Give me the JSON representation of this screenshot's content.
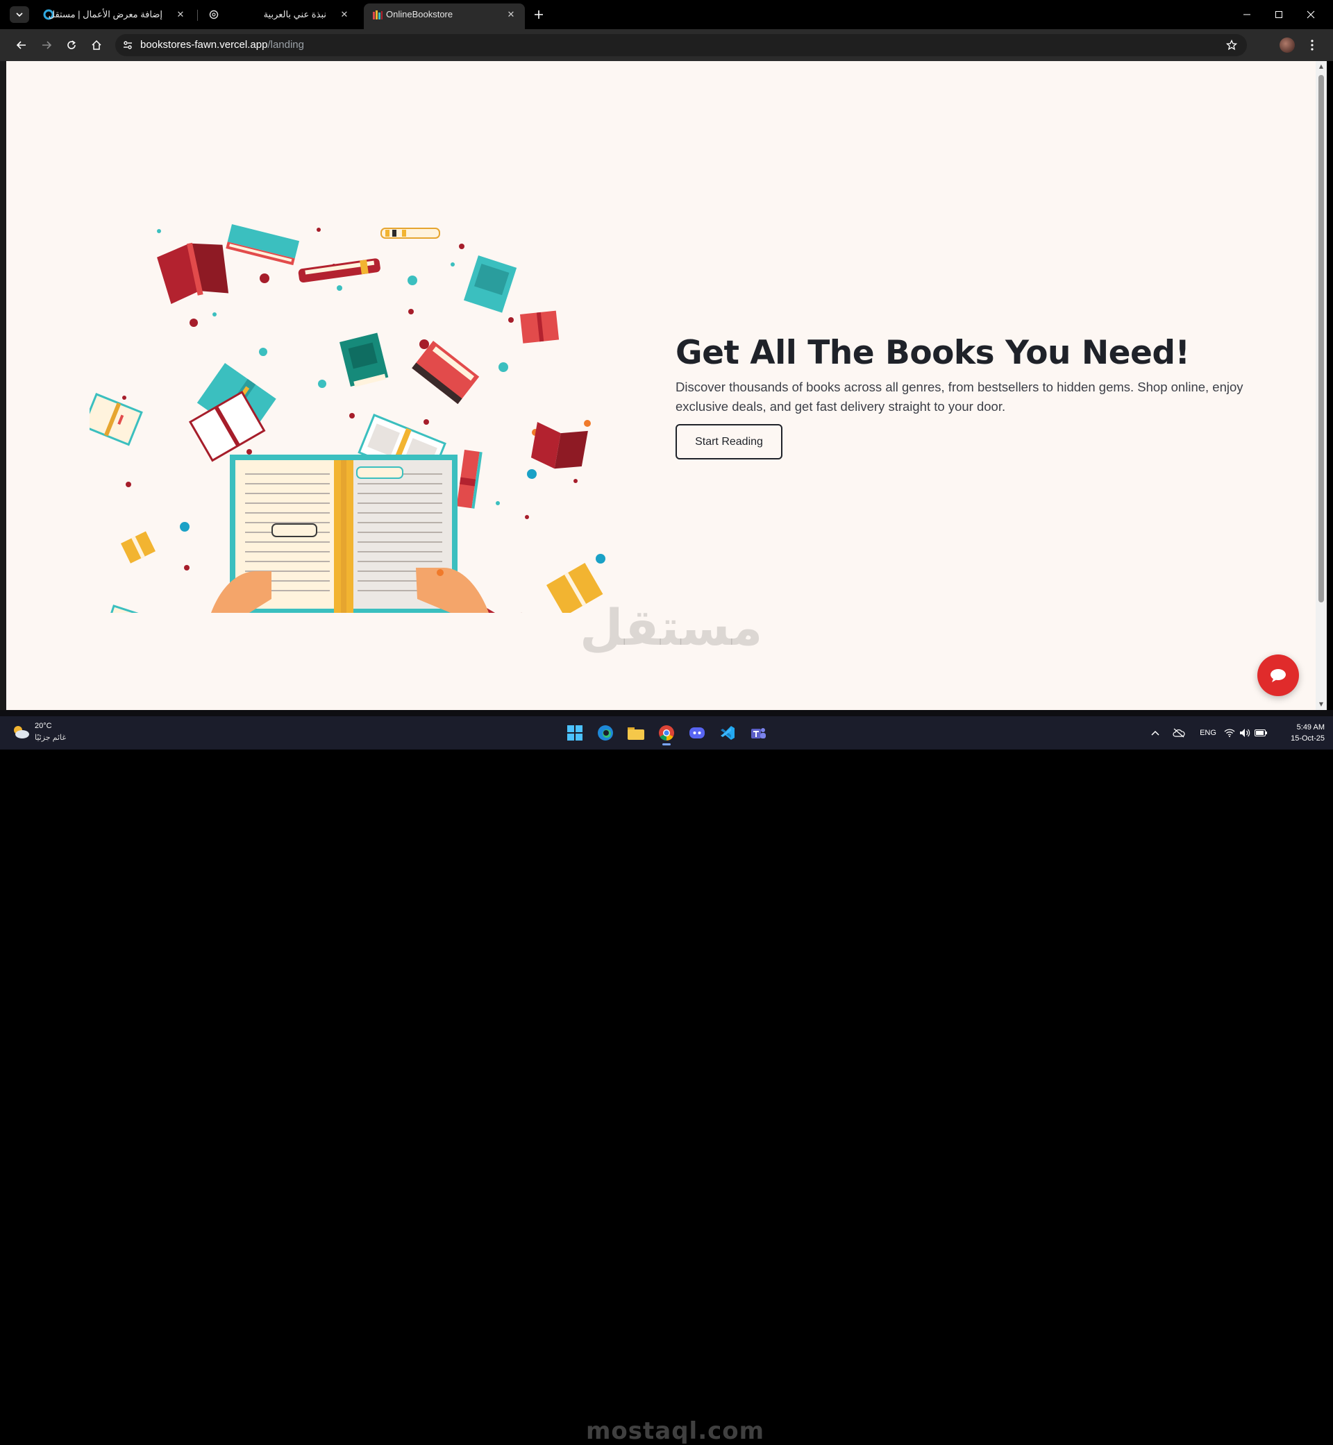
{
  "browser": {
    "tabs": [
      {
        "title": "إضافة معرض الأعمال | مستقل",
        "active": false
      },
      {
        "title": "نبذة عني بالعربية",
        "active": false
      },
      {
        "title": "OnlineBookstore",
        "active": true
      }
    ],
    "url_host": "bookstores-fawn.vercel.app",
    "url_path": "/landing"
  },
  "hero": {
    "title": "Get All The Books You Need!",
    "description": "Discover thousands of books across all genres, from bestsellers to hidden gems. Shop online, enjoy exclusive deals, and get fast delivery straight to your door.",
    "cta_label": "Start Reading"
  },
  "watermark": {
    "arabic": "مستقل",
    "latin": "mostaql.com"
  },
  "taskbar": {
    "weather_temp": "20°C",
    "weather_desc": "غائم جزئيًا",
    "language": "ENG",
    "time": "5:49 AM",
    "date": "15-Oct-25"
  },
  "colors": {
    "page_background": "#fdf7f3",
    "heading": "#1f2229",
    "chat_button": "#e02b2b",
    "book_red": "#b3222f",
    "book_teal": "#3bbfbf",
    "book_yellow": "#f2b431"
  },
  "icons": {
    "chat": "chat-bubble-icon",
    "secure_site": "tune-icon",
    "bookmark": "star-icon"
  }
}
